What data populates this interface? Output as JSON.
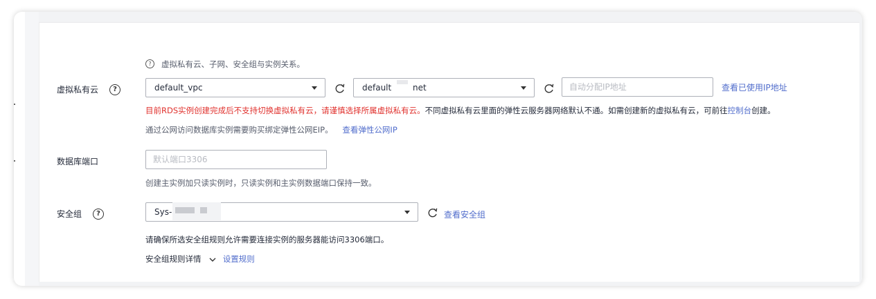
{
  "vpc_section": {
    "hint": "虚拟私有云、子网、安全组与实例关系。",
    "label": "虚拟私有云",
    "vpc_select_value": "default_vpc",
    "subnet_select_value_start": "default",
    "subnet_select_value_end": "net",
    "ip_placeholder": "自动分配IP地址",
    "view_used_ip_link": "查看已使用IP地址",
    "warning_text": "目前RDS实例创建完成后不支持切换虚拟私有云，请谨慎选择所属虚拟私有云。",
    "info_text_before": "不同虚拟私有云里面的弹性云服务器网络默认不通。如需创建新的虚拟私有云，可前往",
    "console_link": "控制台",
    "info_text_after": "创建。",
    "eip_text": "通过公网访问数据库实例需要购买绑定弹性公网EIP。",
    "view_eip_link": "查看弹性公网IP"
  },
  "port_section": {
    "label": "数据库端口",
    "port_placeholder": "默认端口3306",
    "port_hint": "创建主实例加只读实例时，只读实例和主实例数据端口保持一致。"
  },
  "security_section": {
    "label": "安全组",
    "select_value": "Sys-",
    "view_sg_link": "查看安全组",
    "note": "请确保所选安全组规则允许需要连接实例的服务器能访问3306端口。",
    "rules_detail": "安全组规则详情",
    "set_rules_link": "设置规则"
  },
  "icons": {
    "help": "question-circle-icon",
    "refresh": "refresh-icon",
    "dropdown": "caret-down-icon",
    "expand": "chevron-down-icon"
  },
  "colors": {
    "link": "#526ecc",
    "warning": "#e0312d",
    "text": "#252b3a",
    "hint": "#575d6c"
  }
}
